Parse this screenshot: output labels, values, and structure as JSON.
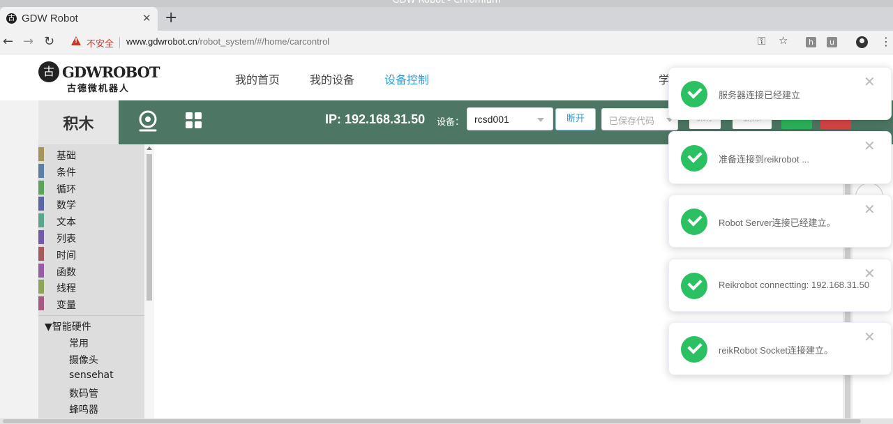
{
  "browser": {
    "window_title": "GDW Robot - Chromium",
    "tab_title": "GDW Robot",
    "favicon_char": "古",
    "security_label": "不安全",
    "url_host": "www.gdwrobot.cn",
    "url_path": "/robot_system/#/home/carcontrol",
    "extensions": [
      "h",
      "u"
    ]
  },
  "site": {
    "logo_char": "古",
    "logo_en": "GDWROBOT",
    "logo_cn": "古德微机器人",
    "nav": [
      "我的首页",
      "我的设备",
      "设备控制"
    ],
    "nav_active": "设备控制",
    "nav_cut": "学"
  },
  "appbar": {
    "tab_label": "积木",
    "ip_text": "IP: 192.168.31.50",
    "device_label": "设备：",
    "device_value": "rcsd001",
    "disconnect_label": "断开",
    "saved_code_placeholder": "已保存代码",
    "save_label": "保存",
    "delete_label": "删除",
    "accent_color": "#4d7764"
  },
  "categories": [
    {
      "label": "基础",
      "color": "#a6955a"
    },
    {
      "label": "条件",
      "color": "#5b80a5"
    },
    {
      "label": "循环",
      "color": "#5ba55b"
    },
    {
      "label": "数学",
      "color": "#5b67a5"
    },
    {
      "label": "文本",
      "color": "#5ba58c"
    },
    {
      "label": "列表",
      "color": "#745ba5"
    },
    {
      "label": "时间",
      "color": "#a55b5b"
    },
    {
      "label": "函数",
      "color": "#995ba5"
    },
    {
      "label": "线程",
      "color": "#8ca55b"
    },
    {
      "label": "变量",
      "color": "#a55b80"
    }
  ],
  "hardware": {
    "header": "▼智能硬件",
    "items": [
      "常用",
      "摄像头",
      "sensehat",
      "数码管",
      "蜂鸣器"
    ]
  },
  "notifications": [
    {
      "message": "服务器连接已经建立"
    },
    {
      "message": "准备连接到reikrobot ..."
    },
    {
      "message": "Robot Server连接已经建立。"
    },
    {
      "message": "Reikrobot connectting: 192.168.31.50"
    },
    {
      "message": "reikRobot Socket连接建立。"
    }
  ]
}
